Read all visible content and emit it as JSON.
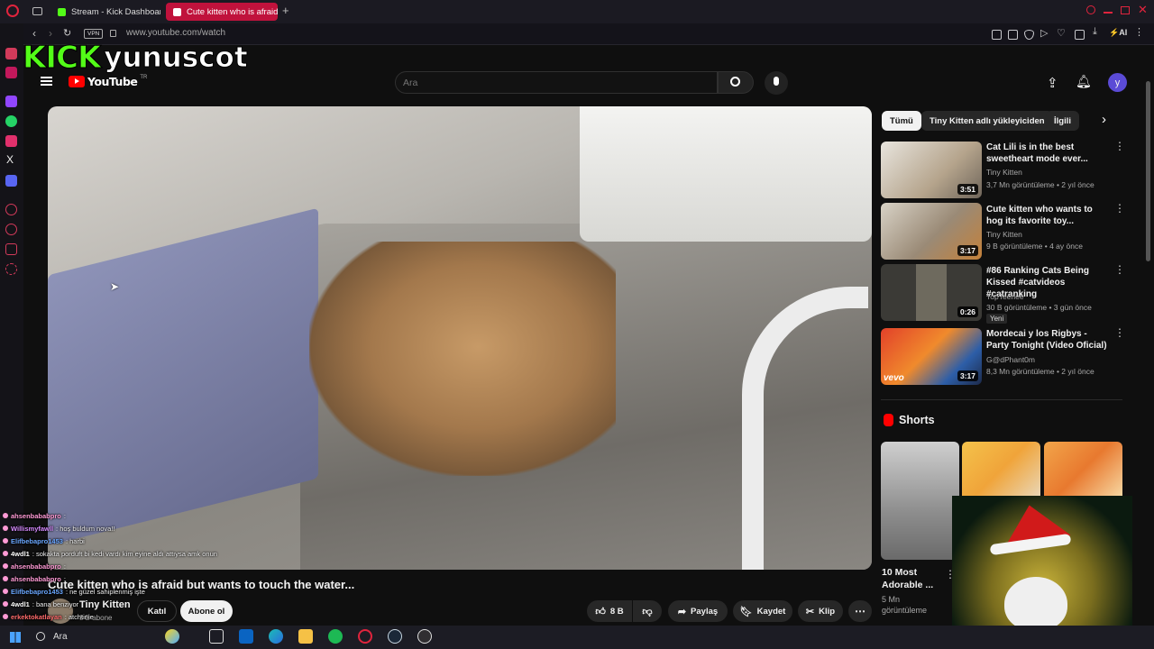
{
  "browser": {
    "tabs": [
      {
        "label": "Stream - Kick Dashboard",
        "active": false
      },
      {
        "label": "Cute kitten who is afraid",
        "active": true
      }
    ],
    "url": "www.youtube.com/watch",
    "vpn_label": "VPN",
    "ai_label": "AI"
  },
  "overlay": {
    "kick_logo": "KICK",
    "streamer_name": "yunuscot"
  },
  "youtube": {
    "logo_text": "YouTube",
    "logo_region": "TR",
    "search_placeholder": "Ara",
    "avatar_letter": "y",
    "chips": [
      "Tümü",
      "Tiny Kitten adlı yükleyiciden",
      "İlgili"
    ],
    "video": {
      "title": "Cute kitten who is afraid but wants to touch the water...",
      "channel": "Tiny Kitten",
      "subscribers": "8 B abone",
      "join_label": "Katıl",
      "subscribe_label": "Abone ol",
      "like_count": "8 B",
      "share_label": "Paylaş",
      "save_label": "Kaydet",
      "clip_label": "Klip"
    },
    "recommendations": [
      {
        "title": "Cat Lili is in the best sweetheart mode ever...",
        "channel": "Tiny Kitten",
        "stats": "3,7 Mn görüntüleme • 2 yıl önce",
        "duration": "3:51",
        "badge": ""
      },
      {
        "title": "Cute kitten who wants to hog its favorite toy...",
        "channel": "Tiny Kitten",
        "stats": "9 B görüntüleme • 4 ay önce",
        "duration": "3:17",
        "badge": ""
      },
      {
        "title": "#86 Ranking Cats Being Kissed #catvideos #catranking",
        "channel": "TopTeehee",
        "stats": "30 B görüntüleme • 3 gün önce",
        "duration": "0:26",
        "badge": "Yeni"
      },
      {
        "title": "Mordecai y los Rigbys - Party Tonight (Video Oficial)",
        "channel": "G@dPhant0m",
        "stats": "8,3 Mn görüntüleme • 2 yıl önce",
        "duration": "3:17",
        "badge": ""
      }
    ],
    "shorts_header": "Shorts",
    "shorts": [
      {
        "title": "10 Most Adorable ...",
        "views": "5 Mn görüntüleme"
      }
    ]
  },
  "chat": [
    {
      "user": "ahsenbababpro",
      "text": ":",
      "color": "#ff9ad5"
    },
    {
      "user": "Willismyfawll",
      "text": ": hoş buldum nova!!",
      "color": "#d78bff"
    },
    {
      "user": "Elifbebapro1453",
      "text": ": harbi",
      "color": "#6aa7ff"
    },
    {
      "user": "4wdl1",
      "text": ": sokakta porduft bi kedi vardı kim eyine aldı attıysa amk onun",
      "color": "#ffffff"
    },
    {
      "user": "ahsenbababpro",
      "text": ":",
      "color": "#ff9ad5"
    },
    {
      "user": "ahsenbababpro",
      "text": ":",
      "color": "#ff9ad5"
    },
    {
      "user": "Elifbebapro1453",
      "text": ": ne güzel sahiplenmiş işte",
      "color": "#6aa7ff"
    },
    {
      "user": "4wdl1",
      "text": ": bana benziyor",
      "color": "#ffffff"
    },
    {
      "user": "erkektokatlayan",
      "text": ": atchtinie",
      "color": "#ff6b6b"
    }
  ],
  "taskbar": {
    "search_label": "Ara"
  },
  "colors": {
    "kick_green": "#53fc18",
    "yt_red": "#ff0000",
    "active_tab": "#c0123c",
    "avatar": "#5b4bd6"
  }
}
